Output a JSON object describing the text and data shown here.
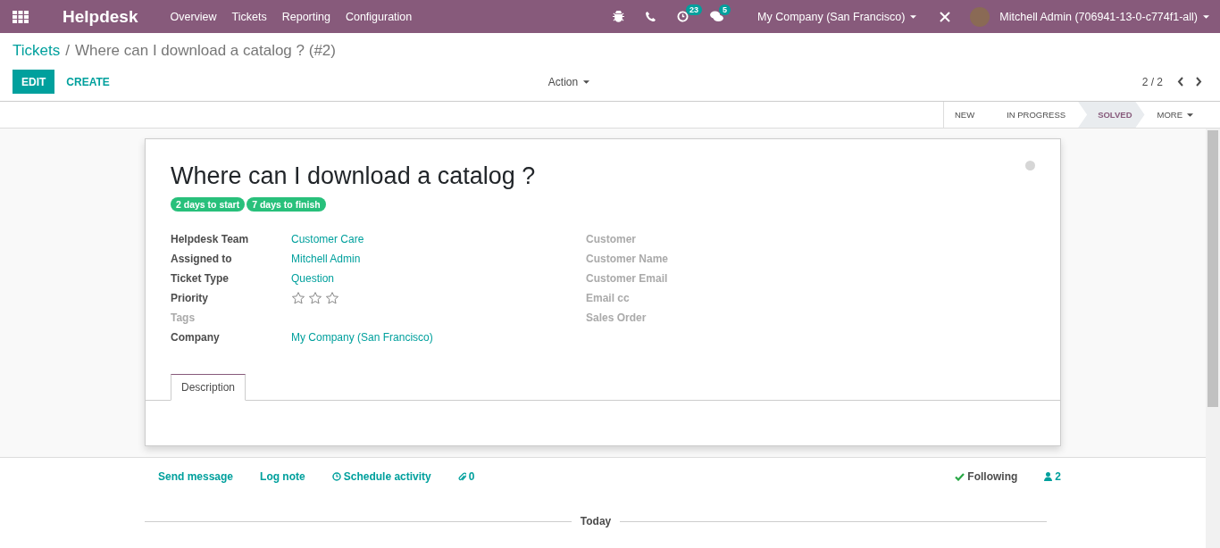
{
  "navbar": {
    "app_name": "Helpdesk",
    "menu": [
      "Overview",
      "Tickets",
      "Reporting",
      "Configuration"
    ],
    "activity_count": "23",
    "message_count": "5",
    "company": "My Company (San Francisco)",
    "user": "Mitchell Admin (706941-13-0-c774f1-all)"
  },
  "breadcrumb": {
    "parent": "Tickets",
    "separator": "/",
    "current": "Where can I download a catalog ? (#2)"
  },
  "buttons": {
    "edit": "EDIT",
    "create": "CREATE",
    "action": "Action"
  },
  "pager": {
    "value": "2 / 2"
  },
  "stages": [
    {
      "label": "NEW",
      "selected": false
    },
    {
      "label": "IN PROGRESS",
      "selected": false
    },
    {
      "label": "SOLVED",
      "selected": true
    }
  ],
  "more": "MORE",
  "ticket": {
    "title": "Where can I download a catalog ?",
    "badges": [
      "2 days to start",
      "7 days to finish"
    ],
    "left_fields": [
      {
        "label": "Helpdesk Team",
        "kind": "link",
        "value": "Customer Care"
      },
      {
        "label": "Assigned to",
        "kind": "link",
        "value": "Mitchell Admin"
      },
      {
        "label": "Ticket Type",
        "kind": "link",
        "value": "Question"
      },
      {
        "label": "Priority",
        "kind": "stars",
        "stars": 0
      },
      {
        "label": "Tags",
        "kind": "empty"
      },
      {
        "label": "Company",
        "kind": "link",
        "value": "My Company (San Francisco)"
      }
    ],
    "right_fields": [
      {
        "label": "Customer",
        "kind": "empty"
      },
      {
        "label": "Customer Name",
        "kind": "empty"
      },
      {
        "label": "Customer Email",
        "kind": "empty"
      },
      {
        "label": "Email cc",
        "kind": "empty"
      },
      {
        "label": "Sales Order",
        "kind": "empty"
      }
    ],
    "tabs": [
      {
        "label": "Description",
        "selected": true
      }
    ]
  },
  "chatter": {
    "send_message": "Send message",
    "log_note": "Log note",
    "schedule_activity": "Schedule activity",
    "attachments": "0",
    "following": "Following",
    "followers": "2",
    "separator": "Today"
  }
}
